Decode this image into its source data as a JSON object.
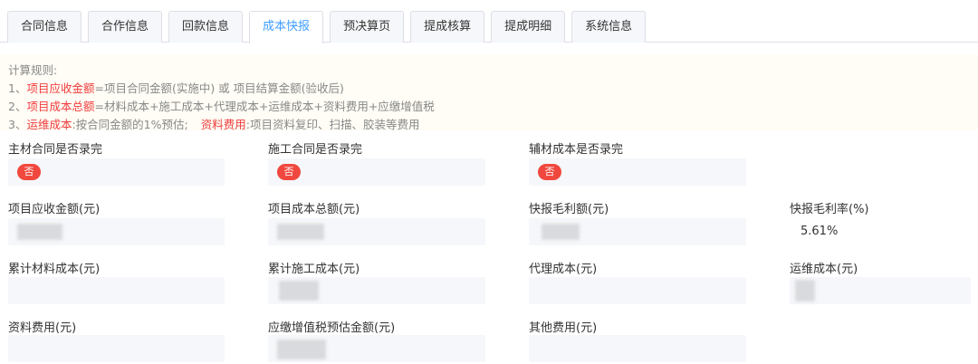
{
  "tabs": [
    {
      "label": "合同信息",
      "active": false
    },
    {
      "label": "合作信息",
      "active": false
    },
    {
      "label": "回款信息",
      "active": false
    },
    {
      "label": "成本快报",
      "active": true
    },
    {
      "label": "预决算页",
      "active": false
    },
    {
      "label": "提成核算",
      "active": false
    },
    {
      "label": "提成明细",
      "active": false
    },
    {
      "label": "系统信息",
      "active": false
    }
  ],
  "rules": {
    "title": "计算规则:",
    "line1_prefix": "1、",
    "line1_key": "项目应收金额",
    "line1_text": "=项目合同金额(实施中) 或 项目结算金额(验收后)",
    "line2_prefix": "2、",
    "line2_key": "项目成本总额",
    "line2_text": "=材料成本+施工成本+代理成本+运维成本+资料费用+应缴增值税",
    "line3_prefix": "3、",
    "line3_key": "运维成本",
    "line3_text": ":按合同金额的1%预估;",
    "line3_key2": "资料费用",
    "line3_text2": ":项目资料复印、扫描、胶装等费用"
  },
  "fields": {
    "main_contract": {
      "label": "主材合同是否录完",
      "value": "否"
    },
    "construction_contract": {
      "label": "施工合同是否录完",
      "value": "否"
    },
    "aux_cost": {
      "label": "辅材成本是否录完",
      "value": "否"
    },
    "receivable": {
      "label": "项目应收金额(元)"
    },
    "total_cost": {
      "label": "项目成本总额(元)"
    },
    "gross_profit": {
      "label": "快报毛利额(元)"
    },
    "gross_margin": {
      "label": "快报毛利率(%)",
      "value": "5.61%"
    },
    "material_cost": {
      "label": "累计材料成本(元)"
    },
    "construction_cost": {
      "label": "累计施工成本(元)"
    },
    "agency_cost": {
      "label": "代理成本(元)"
    },
    "om_cost": {
      "label": "运维成本(元)"
    },
    "doc_fee": {
      "label": "资料费用(元)"
    },
    "vat_estimate": {
      "label": "应缴增值税预估金额(元)"
    },
    "other_fee": {
      "label": "其他费用(元)"
    }
  },
  "colors": {
    "accent": "#409eff",
    "highlight": "#f03c3c",
    "badge": "#f0483e"
  }
}
